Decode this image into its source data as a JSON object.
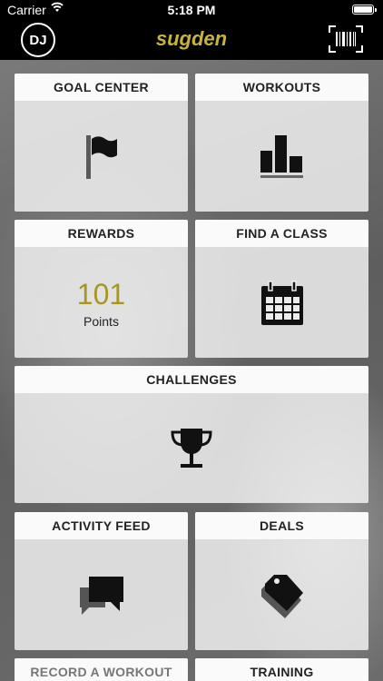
{
  "status_bar": {
    "carrier": "Carrier",
    "time": "5:18 PM",
    "battery_level": 1.0
  },
  "header": {
    "avatar_initials": "DJ",
    "logo_text": "sugden",
    "brand_color": "#c8b43a",
    "barcode_icon": "barcode-scan-icon"
  },
  "tiles": {
    "goal_center": {
      "label": "GOAL CENTER",
      "icon": "flag-icon"
    },
    "workouts": {
      "label": "WORKOUTS",
      "icon": "bar-chart-icon"
    },
    "rewards": {
      "label": "REWARDS",
      "points_value": "101",
      "points_label": "Points"
    },
    "find_a_class": {
      "label": "FIND A CLASS",
      "icon": "calendar-icon"
    },
    "challenges": {
      "label": "CHALLENGES",
      "icon": "trophy-icon"
    },
    "activity_feed": {
      "label": "ACTIVITY FEED",
      "icon": "chat-bubbles-icon"
    },
    "deals": {
      "label": "DEALS",
      "icon": "price-tags-icon"
    },
    "record_a_workout": {
      "label": "RECORD A WORKOUT"
    },
    "training": {
      "label": "TRAINING"
    }
  }
}
